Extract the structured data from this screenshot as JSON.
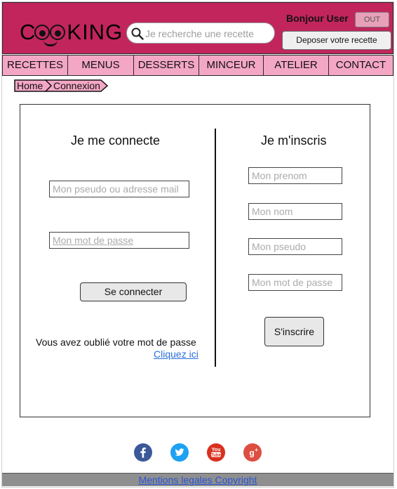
{
  "header": {
    "logo_letters_left": "C",
    "logo_letters_right": "KING",
    "search_placeholder": "Je recherche une recette",
    "greeting": "Bonjour User",
    "out_label": "OUT",
    "deposit_label": "Deposer votre recette",
    "colors": {
      "header_bg": "#c2255c",
      "nav_bg": "#f4a7c4"
    }
  },
  "nav": {
    "items": [
      {
        "label": "RECETTES"
      },
      {
        "label": "MENUS"
      },
      {
        "label": "DESSERTS"
      },
      {
        "label": "MINCEUR"
      },
      {
        "label": "ATELIER"
      },
      {
        "label": "CONTACT"
      }
    ]
  },
  "breadcrumb": {
    "items": [
      {
        "label": "Home"
      },
      {
        "label": "Connexion"
      }
    ]
  },
  "login": {
    "title": "Je me connecte",
    "pseudo_placeholder": "Mon pseudo ou adresse mail",
    "password_placeholder": "Mon mot de passe",
    "submit_label": "Se connecter",
    "forgot_text": "Vous avez oublié votre mot de passe",
    "forgot_link": "Cliquez ici"
  },
  "signup": {
    "title": "Je m'inscris",
    "firstname_placeholder": "Mon prenom",
    "lastname_placeholder": "Mon nom",
    "pseudo_placeholder": "Mon pseudo",
    "password_placeholder": "Mon mot de passe",
    "submit_label": "S'inscrire"
  },
  "social": {
    "icons": [
      "facebook-icon",
      "twitter-icon",
      "youtube-icon",
      "google-plus-icon"
    ],
    "youtube_text": "You Tube",
    "google_text": "g+",
    "colors": {
      "facebook": "#3b5998",
      "twitter": "#1da1f2",
      "youtube": "#d9301f",
      "google": "#dc4e41"
    }
  },
  "footer": {
    "text": "Mentions legales  Copyright"
  }
}
